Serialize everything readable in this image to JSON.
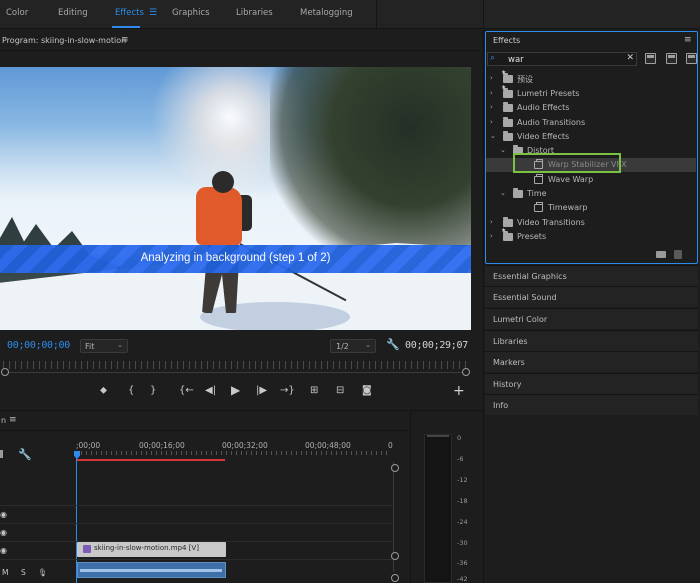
{
  "workspaces": {
    "items": [
      "Color",
      "Editing",
      "Effects",
      "Graphics",
      "Libraries",
      "Metalogging"
    ],
    "active": "Effects",
    "menu_icon": "hamburger-icon"
  },
  "program": {
    "title": "Program: skiing-in-slow-motion",
    "menu_icon": "hamburger-icon",
    "overlay_text": "Analyzing in background (step 1 of 2)",
    "timecode_current": "00;00;00;00",
    "timecode_end": "00;00;29;07",
    "fit_value": "Fit",
    "resolution_value": "1/2",
    "settings_icon": "wrench-icon"
  },
  "transport": {
    "icons": [
      "marker-icon",
      "mark-in-icon",
      "mark-out-icon",
      "go-to-in-icon",
      "step-back-icon",
      "play-icon",
      "step-forward-icon",
      "go-to-out-icon",
      "lift-icon",
      "extract-icon",
      "export-frame-icon",
      "add-button-icon"
    ]
  },
  "timeline": {
    "header_label": "n",
    "menu_icon": "hamburger-icon",
    "ticks": [
      ";00;00",
      "00;00;16;00",
      "00;00;32;00",
      "00;00;48;00",
      "0"
    ],
    "clip_label": "skiing-in-slow-motion.mp4 [V]",
    "fx_badge": "fx",
    "track_m": "M",
    "track_s": "S",
    "mic_icon": "microphone-icon",
    "eye_icon": "eye-icon"
  },
  "meter": {
    "labels": [
      "0",
      "-6",
      "-12",
      "-18",
      "-24",
      "-30",
      "-36",
      "-42"
    ]
  },
  "effects": {
    "title": "Effects",
    "menu_icon": "hamburger-icon",
    "search_value": "war",
    "search_icon": "search-icon",
    "clear_icon": "close-icon",
    "tree": [
      {
        "label": "预设",
        "depth": 0,
        "arrow": "›",
        "icon": "star-folder"
      },
      {
        "label": "Lumetri Presets",
        "depth": 0,
        "arrow": "›",
        "icon": "star-folder"
      },
      {
        "label": "Audio Effects",
        "depth": 0,
        "arrow": "›",
        "icon": "folder"
      },
      {
        "label": "Audio Transitions",
        "depth": 0,
        "arrow": "›",
        "icon": "folder"
      },
      {
        "label": "Video Effects",
        "depth": 0,
        "arrow": "⌄",
        "icon": "folder"
      },
      {
        "label": "Distort",
        "depth": 1,
        "arrow": "⌄",
        "icon": "folder"
      },
      {
        "label": "Warp Stabilizer VFX",
        "depth": 2,
        "arrow": "",
        "icon": "fx"
      },
      {
        "label": "Wave Warp",
        "depth": 2,
        "arrow": "",
        "icon": "fx"
      },
      {
        "label": "Time",
        "depth": 1,
        "arrow": "⌄",
        "icon": "folder"
      },
      {
        "label": "Timewarp",
        "depth": 2,
        "arrow": "",
        "icon": "fx"
      },
      {
        "label": "Video Transitions",
        "depth": 0,
        "arrow": "›",
        "icon": "folder"
      },
      {
        "label": "Presets",
        "depth": 0,
        "arrow": "›",
        "icon": "star-folder"
      }
    ],
    "selected": "Warp Stabilizer VFX"
  },
  "panels": [
    "Essential Graphics",
    "Essential Sound",
    "Lumetri Color",
    "Libraries",
    "Markers",
    "History",
    "Info"
  ],
  "colors": {
    "accent": "#2d8ceb",
    "highlight_box": "#7cc242",
    "overlay": "#1f5fd9"
  }
}
